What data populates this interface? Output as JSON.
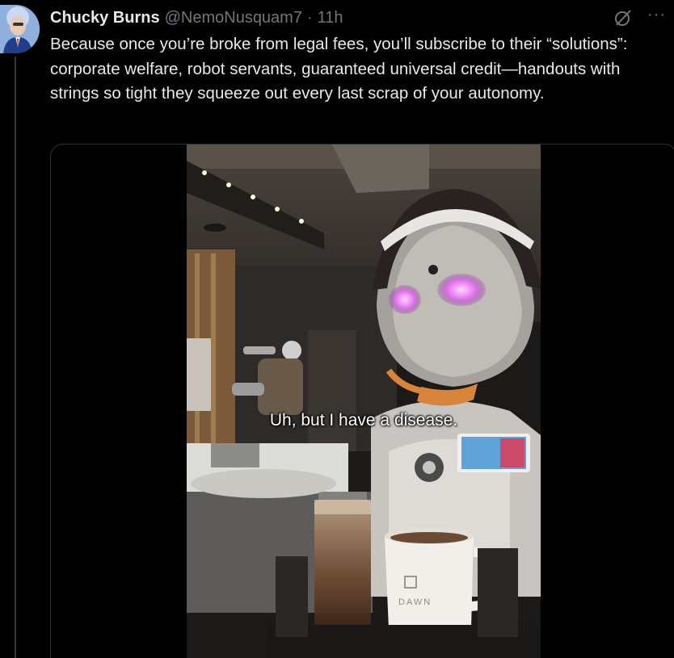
{
  "tweet": {
    "author_name": "Chucky Burns",
    "handle": "@NemoNusquam7",
    "separator": "·",
    "time": "11h",
    "text": "Because once you’re broke from legal fees, you’ll subscribe to their “solutions”: corporate welfare, robot servants, guaranteed universal credit—handouts with strings so tight they squeeze out every last scrap of your autonomy.",
    "more_label": "···"
  },
  "media": {
    "type": "video",
    "subtitle": "Uh, but I have a disease.",
    "mug_logo_text": "DAWN"
  },
  "icons": {
    "grok": "grok-icon",
    "more": "more-options-icon"
  }
}
